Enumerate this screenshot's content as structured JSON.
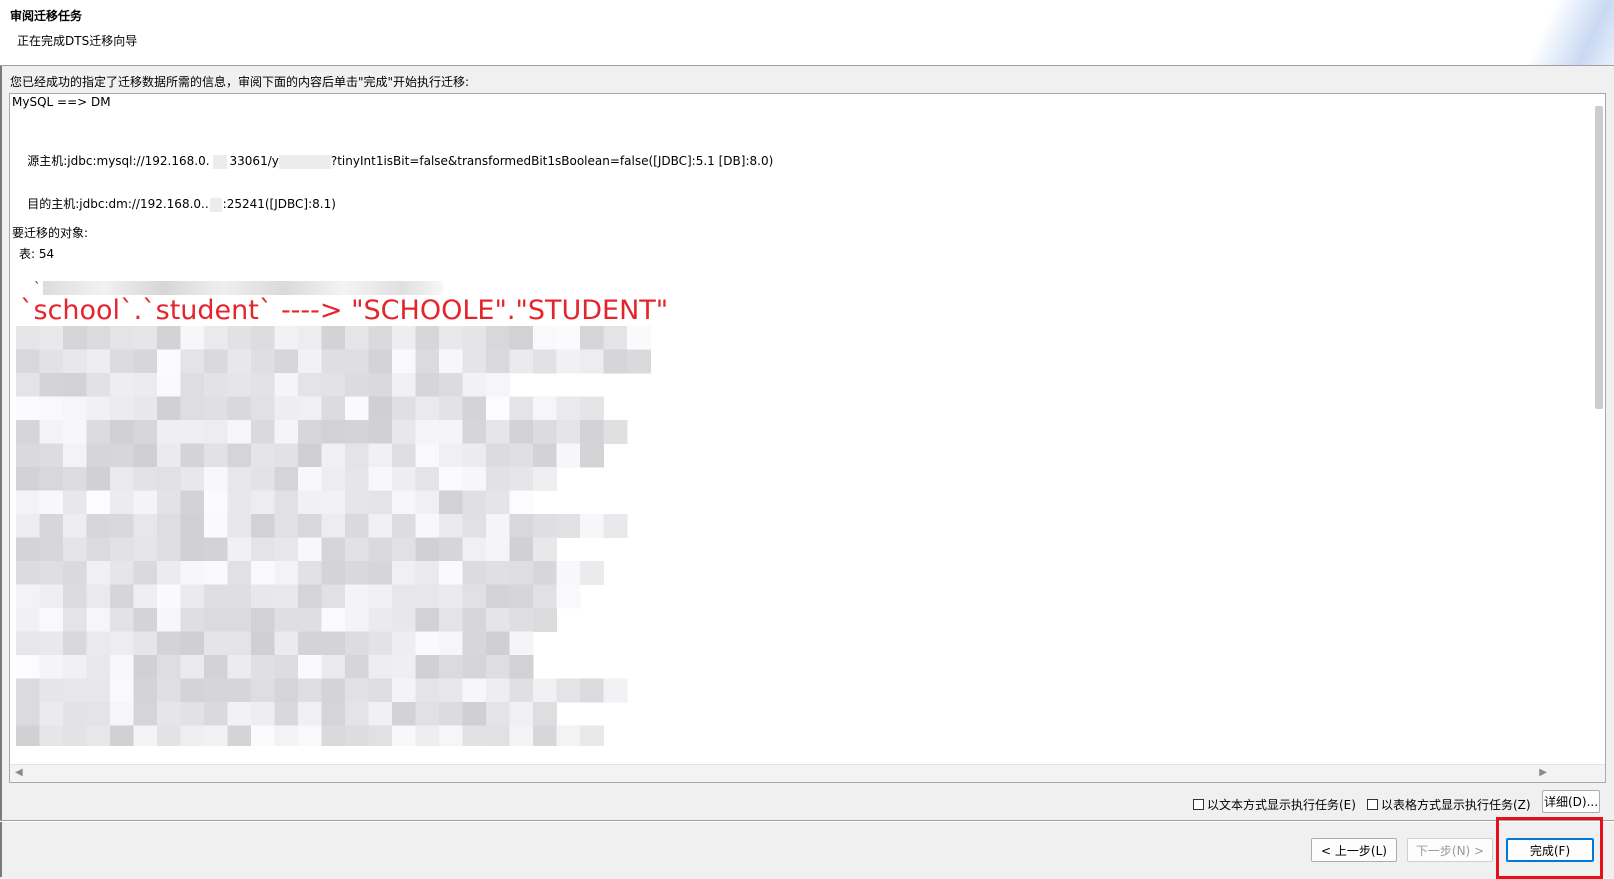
{
  "header": {
    "title": "审阅迁移任务",
    "subtitle": "正在完成DTS迁移向导"
  },
  "instruction": "您已经成功的指定了迁移数据所需的信息，审阅下面的内容后单击\"完成\"开始执行迁移:",
  "summary": {
    "direction": "MySQL ==> DM",
    "source_prefix": "源主机:jdbc:mysql://192.168.0.",
    "source_port": "33061/y",
    "source_suffix": "?tinyInt1isBit=false&transformedBit1sBoolean=false([JDBC]:5.1 [DB]:8.0)",
    "target_prefix": "目的主机:jdbc:dm://192.168.0..",
    "target_suffix": ":25241([JDBC]:8.1)",
    "objects_label": "要迁移的对象:",
    "table_count": "表: 54",
    "redacted_start": "`"
  },
  "annotation": "`school`.`student` ----> \"SCHOOLE\".\"STUDENT\"",
  "options": {
    "text_mode_label": "以文本方式显示执行任务(E)",
    "table_mode_label": "以表格方式显示执行任务(Z)",
    "details_button": "详细(D)..."
  },
  "buttons": {
    "back": "< 上一步(L)",
    "next": "下一步(N) >",
    "finish": "完成(F)"
  },
  "colors": {
    "annotation": "#e4252c",
    "highlight": "#e4101c",
    "primary_border": "#0078d7"
  }
}
